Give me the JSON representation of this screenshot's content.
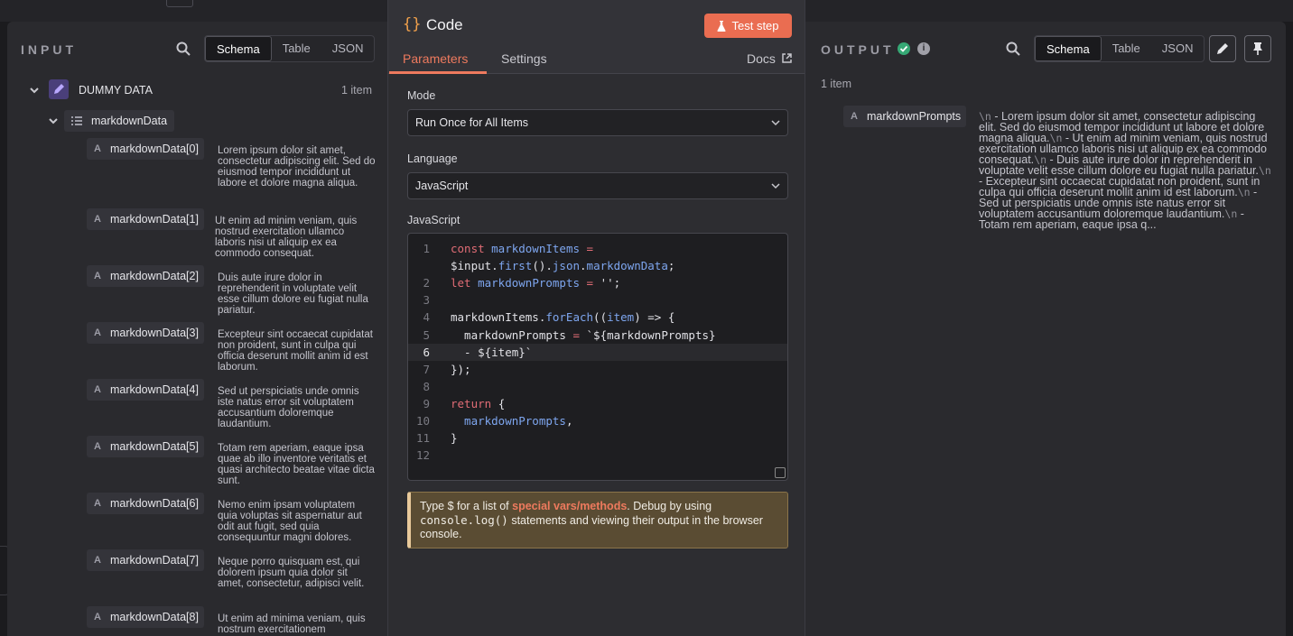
{
  "input": {
    "title": "INPUT",
    "tabs": [
      "Schema",
      "Table",
      "JSON"
    ],
    "node_name": "DUMMY DATA",
    "item_count": "1 item",
    "field_name": "markdownData",
    "rows": [
      {
        "key": "markdownData[0]",
        "value": "Lorem ipsum dolor sit amet, consectetur adipiscing elit. Sed do eiusmod tempor incididunt ut labore et dolore magna aliqua."
      },
      {
        "key": "markdownData[1]",
        "value": "Ut enim ad minim veniam, quis nostrud exercitation ullamco laboris nisi ut aliquip ex ea commodo consequat."
      },
      {
        "key": "markdownData[2]",
        "value": "Duis aute irure dolor in reprehenderit in voluptate velit esse cillum dolore eu fugiat nulla pariatur."
      },
      {
        "key": "markdownData[3]",
        "value": "Excepteur sint occaecat cupidatat non proident, sunt in culpa qui officia deserunt mollit anim id est laborum."
      },
      {
        "key": "markdownData[4]",
        "value": "Sed ut perspiciatis unde omnis iste natus error sit voluptatem accusantium doloremque laudantium."
      },
      {
        "key": "markdownData[5]",
        "value": "Totam rem aperiam, eaque ipsa quae ab illo inventore veritatis et quasi architecto beatae vitae dicta sunt."
      },
      {
        "key": "markdownData[6]",
        "value": "Nemo enim ipsam voluptatem quia voluptas sit aspernatur aut odit aut fugit, sed quia consequuntur magni dolores."
      },
      {
        "key": "markdownData[7]",
        "value": "Neque porro quisquam est, qui dolorem ipsum quia dolor sit amet, consectetur, adipisci velit."
      },
      {
        "key": "markdownData[8]",
        "value": "Ut enim ad minima veniam, quis nostrum exercitationem"
      }
    ]
  },
  "code": {
    "braces": "{}",
    "title": "Code",
    "test_button": "Test step",
    "tabs": [
      "Parameters",
      "Settings"
    ],
    "docs": "Docs",
    "mode_label": "Mode",
    "mode_value": "Run Once for All Items",
    "language_label": "Language",
    "language_value": "JavaScript",
    "editor_label": "JavaScript",
    "line_numbers": [
      "1",
      "",
      "2",
      "3",
      "4",
      "5",
      "",
      "6",
      "7",
      "8",
      "9",
      "10",
      "11",
      "12"
    ],
    "lines": [
      {
        "parts": [
          [
            "kw",
            "const "
          ],
          [
            "var",
            "markdownItems "
          ],
          [
            "kw",
            "="
          ]
        ]
      },
      {
        "parts": [
          [
            "plain",
            "$input."
          ],
          [
            "var",
            "first"
          ],
          [
            "plain",
            "()."
          ],
          [
            "var",
            "json"
          ],
          [
            "plain",
            "."
          ],
          [
            "var",
            "markdownData"
          ],
          [
            "plain",
            ";"
          ]
        ]
      },
      {
        "parts": [
          [
            "kw",
            "let "
          ],
          [
            "var",
            "markdownPrompts "
          ],
          [
            "kw",
            "= "
          ],
          [
            "str",
            "'';"
          ]
        ]
      },
      {
        "parts": []
      },
      {
        "parts": [
          [
            "plain",
            "markdownItems."
          ],
          [
            "var",
            "forEach"
          ],
          [
            "plain",
            "(("
          ],
          [
            "var",
            "item"
          ],
          [
            "plain",
            ") => {"
          ]
        ]
      },
      {
        "parts": [
          [
            "plain",
            "  markdownPrompts "
          ],
          [
            "kw",
            "= "
          ],
          [
            "plain",
            "`${markdownPrompts}"
          ]
        ]
      },
      {
        "parts": [
          [
            "plain",
            "  - ${item}`"
          ]
        ]
      },
      {
        "parts": [
          [
            "plain",
            "});"
          ]
        ]
      },
      {
        "parts": []
      },
      {
        "parts": [
          [
            "kw",
            "return "
          ],
          [
            "plain",
            "{"
          ]
        ]
      },
      {
        "parts": [
          [
            "var",
            "  markdownPrompts"
          ],
          [
            "plain",
            ","
          ]
        ]
      },
      {
        "parts": [
          [
            "plain",
            "}"
          ]
        ]
      },
      {
        "parts": []
      }
    ],
    "hint": {
      "prefix": "Type $ for a list of ",
      "link": "special vars/methods",
      "middle": ". Debug by using ",
      "code": "console.log()",
      "suffix": " statements and viewing their output in the browser console."
    }
  },
  "output": {
    "title": "OUTPUT",
    "tabs": [
      "Schema",
      "Table",
      "JSON"
    ],
    "item_count": "1 item",
    "key": "markdownPrompts",
    "value_segments": [
      [
        "nl",
        "\\n"
      ],
      [
        "t",
        " - Lorem ipsum dolor sit amet, consectetur adipiscing elit. Sed do eiusmod tempor incididunt ut labore et dolore magna aliqua."
      ],
      [
        "nl",
        "\\n"
      ],
      [
        "t",
        " - Ut enim ad minim veniam, quis nostrud exercitation ullamco laboris nisi ut aliquip ex ea commodo consequat."
      ],
      [
        "nl",
        "\\n"
      ],
      [
        "t",
        " - Duis aute irure dolor in reprehenderit in voluptate velit esse cillum dolore eu fugiat nulla pariatur."
      ],
      [
        "nl",
        "\\n"
      ],
      [
        "t",
        " - Excepteur sint occaecat cupidatat non proident, sunt in culpa qui officia deserunt mollit anim id est laborum."
      ],
      [
        "nl",
        "\\n"
      ],
      [
        "t",
        " - Sed ut perspiciatis unde omnis iste natus error sit voluptatem accusantium doloremque laudantium."
      ],
      [
        "nl",
        "\\n"
      ],
      [
        "t",
        " - Totam rem aperiam, eaque ipsa q..."
      ]
    ]
  },
  "colors": {
    "accent": "#ea6d51",
    "success": "#36a875",
    "hint_bg": "#5a4c33"
  }
}
